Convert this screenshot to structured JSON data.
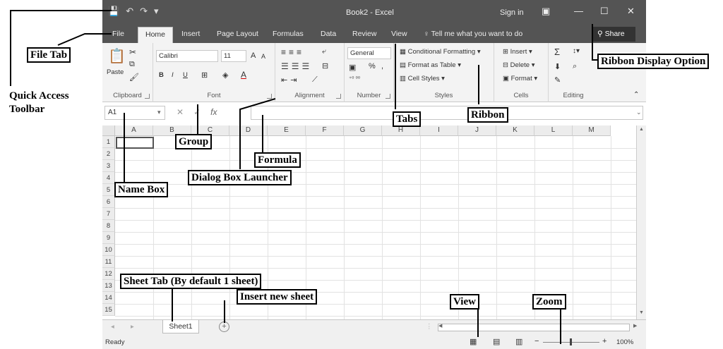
{
  "titlebar": {
    "qat_icons": [
      "save-icon",
      "undo-icon",
      "redo-icon",
      "customize-icon"
    ],
    "title": "Book2 - Excel",
    "signin": "Sign in",
    "ribbon_display_icon": "ribbon-display-icon",
    "min": "—",
    "max": "☐",
    "close": "✕"
  },
  "tabs": [
    "File",
    "Home",
    "Insert",
    "Page Layout",
    "Formulas",
    "Data",
    "Review",
    "View"
  ],
  "tell_me": "Tell me what you want to do",
  "share": "Share",
  "ribbon": {
    "clipboard": {
      "label": "Clipboard",
      "paste": "Paste"
    },
    "font": {
      "label": "Font",
      "font_name": "Calibri",
      "font_size": "11",
      "bold": "B",
      "italic": "I",
      "underline": "U",
      "grow": "A",
      "shrink": "A"
    },
    "alignment": {
      "label": "Alignment"
    },
    "number": {
      "label": "Number",
      "format": "General",
      "percent": "%",
      "comma": ","
    },
    "styles": {
      "label": "Styles",
      "conditional": "Conditional Formatting",
      "format_table": "Format as Table",
      "cell_styles": "Cell Styles"
    },
    "cells": {
      "label": "Cells",
      "insert": "Insert",
      "delete": "Delete",
      "format": "Format"
    },
    "editing": {
      "label": "Editing",
      "sum": "Σ"
    }
  },
  "formula_bar": {
    "namebox": "A1",
    "fx": "fx",
    "cancel": "✕",
    "enter": "✓"
  },
  "columns": [
    "A",
    "B",
    "C",
    "D",
    "E",
    "F",
    "G",
    "H",
    "I",
    "J",
    "K",
    "L",
    "M"
  ],
  "rows": [
    "1",
    "2",
    "3",
    "4",
    "5",
    "6",
    "7",
    "8",
    "9",
    "10",
    "11",
    "12",
    "13",
    "14",
    "15"
  ],
  "sheet_tab": "Sheet1",
  "status": {
    "ready": "Ready",
    "zoom": "100%",
    "minus": "−",
    "plus": "+"
  },
  "annotations": {
    "quick_access": "Quick Access Toolbar",
    "file_tab": "File Tab",
    "ribbon_display": "Ribbon Display Option",
    "tabs": "Tabs",
    "ribbon": "Ribbon",
    "group": "Group",
    "formula": "Formula",
    "dialog_launcher": "Dialog Box Launcher",
    "name_box": "Name Box",
    "sheet_tab": "Sheet Tab (By default 1 sheet)",
    "insert_sheet": "Insert new sheet",
    "view": "View",
    "zoom": "Zoom"
  }
}
